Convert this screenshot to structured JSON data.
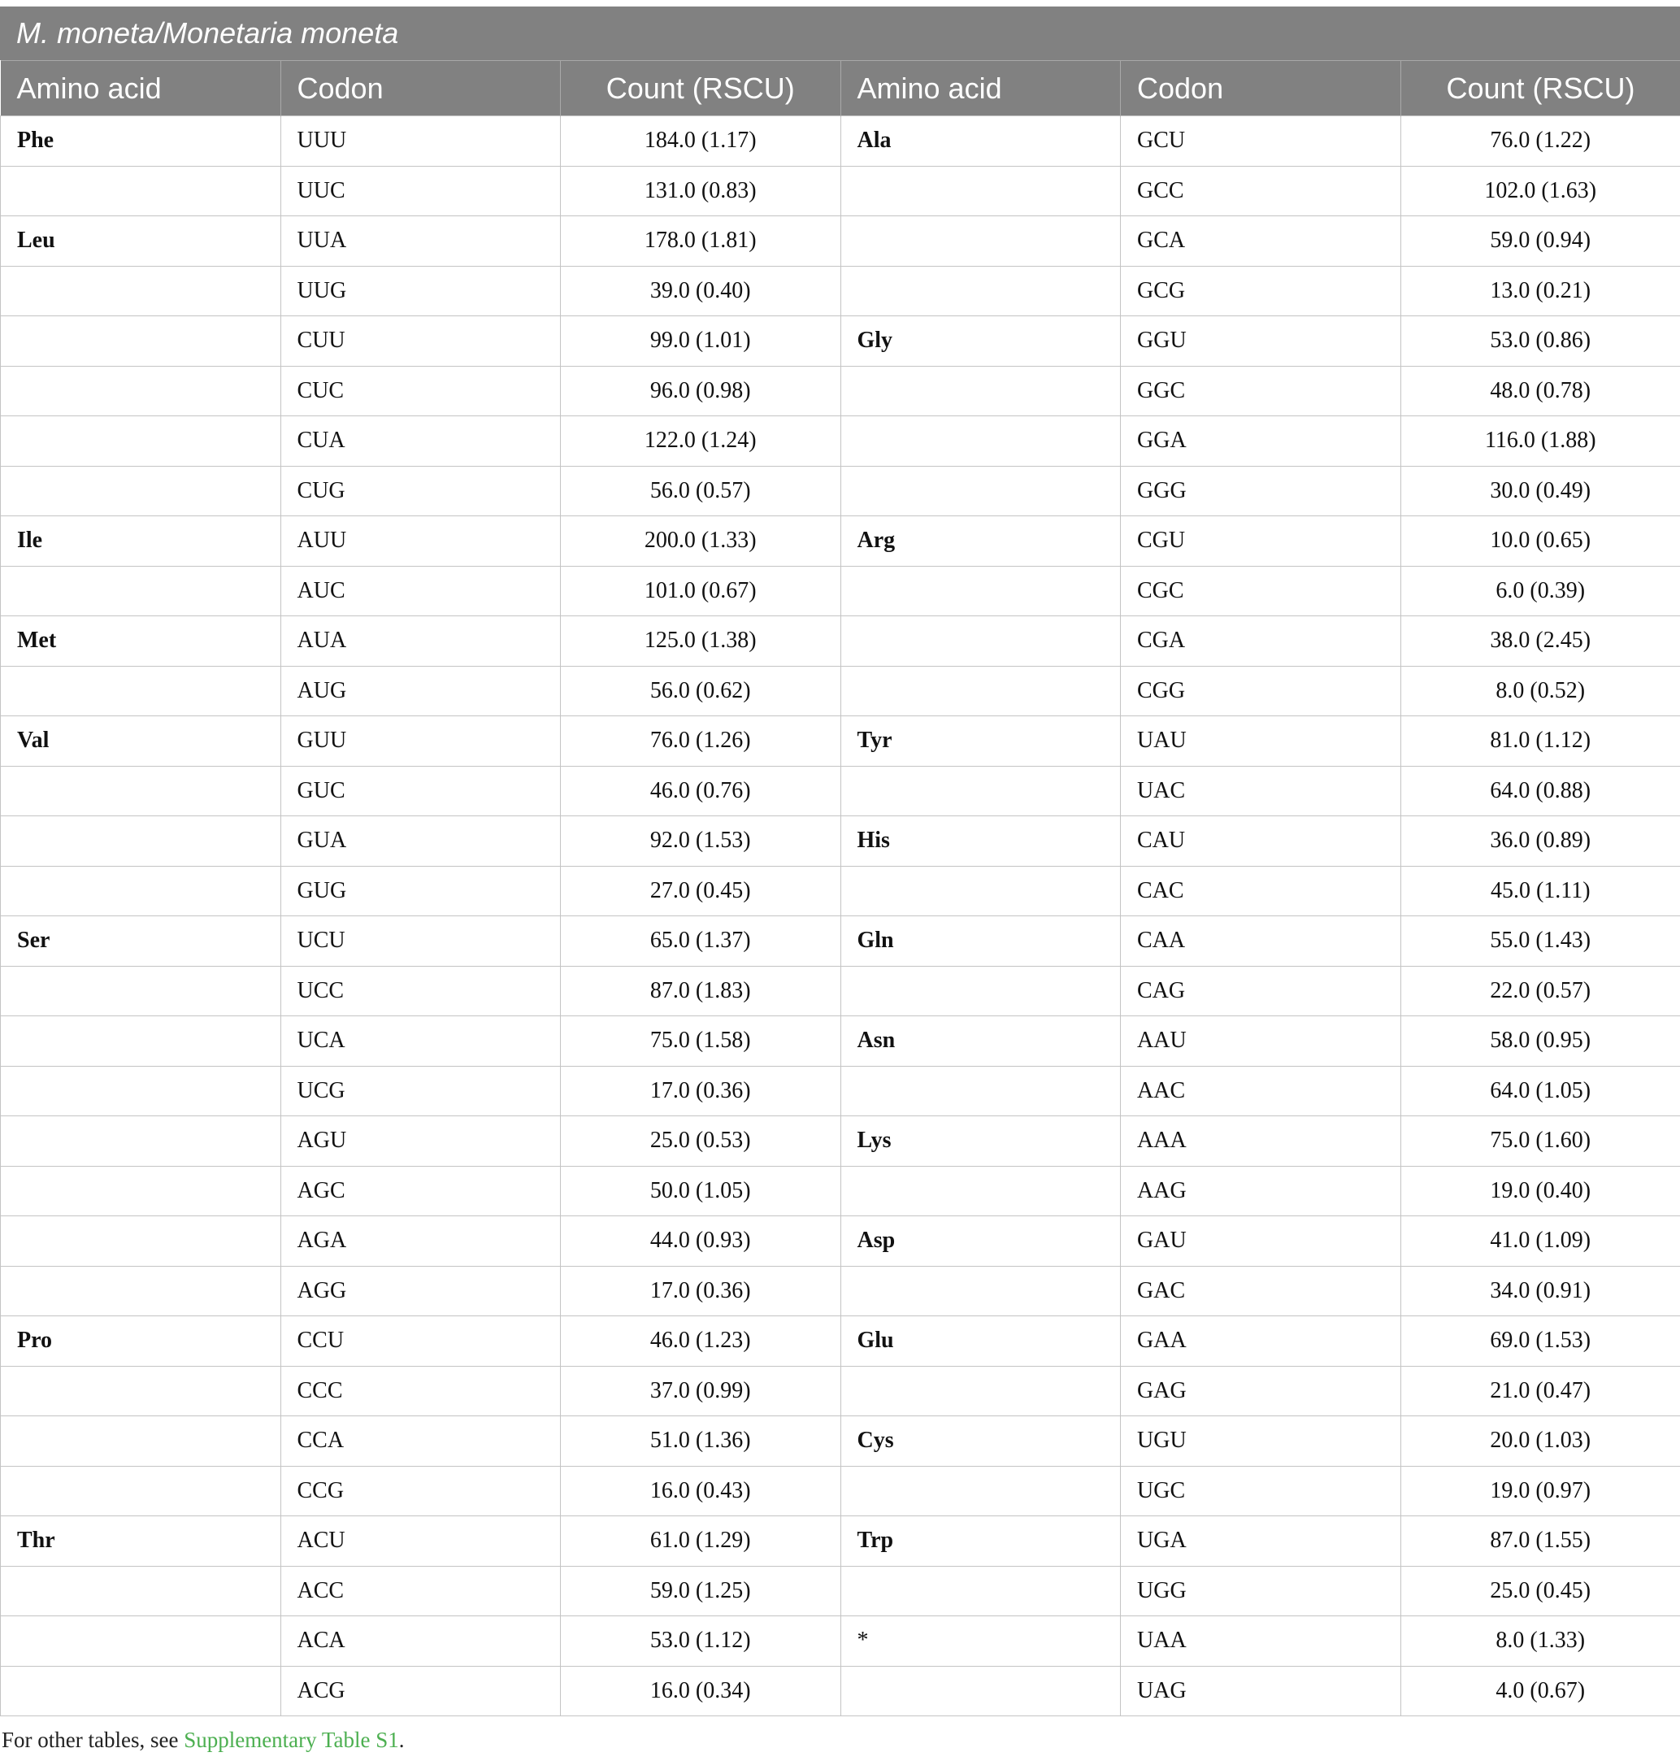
{
  "title": "M. moneta/Monetaria moneta",
  "headers": [
    "Amino acid",
    "Codon",
    "Count (RSCU)",
    "Amino acid",
    "Codon",
    "Count (RSCU)"
  ],
  "rows": [
    [
      "Phe",
      "UUU",
      "184.0 (1.17)",
      "Ala",
      "GCU",
      "76.0 (1.22)"
    ],
    [
      "",
      "UUC",
      "131.0 (0.83)",
      "",
      "GCC",
      "102.0 (1.63)"
    ],
    [
      "Leu",
      "UUA",
      "178.0 (1.81)",
      "",
      "GCA",
      "59.0 (0.94)"
    ],
    [
      "",
      "UUG",
      "39.0 (0.40)",
      "",
      "GCG",
      "13.0 (0.21)"
    ],
    [
      "",
      "CUU",
      "99.0 (1.01)",
      "Gly",
      "GGU",
      "53.0 (0.86)"
    ],
    [
      "",
      "CUC",
      "96.0 (0.98)",
      "",
      "GGC",
      "48.0 (0.78)"
    ],
    [
      "",
      "CUA",
      "122.0 (1.24)",
      "",
      "GGA",
      "116.0 (1.88)"
    ],
    [
      "",
      "CUG",
      "56.0 (0.57)",
      "",
      "GGG",
      "30.0 (0.49)"
    ],
    [
      "Ile",
      "AUU",
      "200.0 (1.33)",
      "Arg",
      "CGU",
      "10.0 (0.65)"
    ],
    [
      "",
      "AUC",
      "101.0 (0.67)",
      "",
      "CGC",
      "6.0 (0.39)"
    ],
    [
      "Met",
      "AUA",
      "125.0 (1.38)",
      "",
      "CGA",
      "38.0 (2.45)"
    ],
    [
      "",
      "AUG",
      "56.0 (0.62)",
      "",
      "CGG",
      "8.0 (0.52)"
    ],
    [
      "Val",
      "GUU",
      "76.0 (1.26)",
      "Tyr",
      "UAU",
      "81.0 (1.12)"
    ],
    [
      "",
      "GUC",
      "46.0 (0.76)",
      "",
      "UAC",
      "64.0 (0.88)"
    ],
    [
      "",
      "GUA",
      "92.0 (1.53)",
      "His",
      "CAU",
      "36.0 (0.89)"
    ],
    [
      "",
      "GUG",
      "27.0 (0.45)",
      "",
      "CAC",
      "45.0 (1.11)"
    ],
    [
      "Ser",
      "UCU",
      "65.0 (1.37)",
      "Gln",
      "CAA",
      "55.0 (1.43)"
    ],
    [
      "",
      "UCC",
      "87.0 (1.83)",
      "",
      "CAG",
      "22.0 (0.57)"
    ],
    [
      "",
      "UCA",
      "75.0 (1.58)",
      "Asn",
      "AAU",
      "58.0 (0.95)"
    ],
    [
      "",
      "UCG",
      "17.0 (0.36)",
      "",
      "AAC",
      "64.0 (1.05)"
    ],
    [
      "",
      "AGU",
      "25.0 (0.53)",
      "Lys",
      "AAA",
      "75.0 (1.60)"
    ],
    [
      "",
      "AGC",
      "50.0 (1.05)",
      "",
      "AAG",
      "19.0 (0.40)"
    ],
    [
      "",
      "AGA",
      "44.0 (0.93)",
      "Asp",
      "GAU",
      "41.0 (1.09)"
    ],
    [
      "",
      "AGG",
      "17.0 (0.36)",
      "",
      "GAC",
      "34.0 (0.91)"
    ],
    [
      "Pro",
      "CCU",
      "46.0 (1.23)",
      "Glu",
      "GAA",
      "69.0 (1.53)"
    ],
    [
      "",
      "CCC",
      "37.0 (0.99)",
      "",
      "GAG",
      "21.0 (0.47)"
    ],
    [
      "",
      "CCA",
      "51.0 (1.36)",
      "Cys",
      "UGU",
      "20.0 (1.03)"
    ],
    [
      "",
      "CCG",
      "16.0 (0.43)",
      "",
      "UGC",
      "19.0 (0.97)"
    ],
    [
      "Thr",
      "ACU",
      "61.0 (1.29)",
      "Trp",
      "UGA",
      "87.0 (1.55)"
    ],
    [
      "",
      "ACC",
      "59.0 (1.25)",
      "",
      "UGG",
      "25.0 (0.45)"
    ],
    [
      "",
      "ACA",
      "53.0 (1.12)",
      "*",
      "UAA",
      "8.0 (1.33)"
    ],
    [
      "",
      "ACG",
      "16.0 (0.34)",
      "",
      "UAG",
      "4.0 (0.67)"
    ]
  ],
  "footnote": {
    "prefix": "For other tables, see ",
    "link": "Supplementary Table S1",
    "suffix": "."
  },
  "colors": {
    "header_bg": "#818181",
    "header_text": "#ffffff",
    "grid": "#c4c4c4",
    "link": "#4caf50"
  }
}
